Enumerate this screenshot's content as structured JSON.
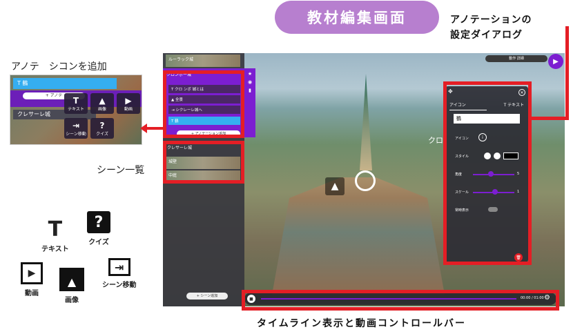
{
  "header": {
    "title": "教材編集画面",
    "dialog_callout": [
      "アノテーションの",
      "設定ダイアログ"
    ],
    "timeline_callout": "タイムライン表示と動画コントロールバー",
    "scene_list_label": "シーン一覧",
    "annotation_add_label": "アノテ　シコンを追加"
  },
  "legend": [
    {
      "icon": "text-icon",
      "glyph": "T",
      "label": "テキスト"
    },
    {
      "icon": "quiz-icon",
      "glyph": "?",
      "label": "クイズ"
    },
    {
      "icon": "video-icon",
      "glyph": "▶",
      "label": "動画"
    },
    {
      "icon": "image-icon",
      "glyph": "▲",
      "label": "画像"
    },
    {
      "icon": "scene-move-icon",
      "glyph": "⇥",
      "label": "シーン移動"
    }
  ],
  "inset": {
    "bar_label": "T 鶴",
    "add_button": "+ アノテ",
    "scene_label": "クレサーレ城",
    "tiles": [
      {
        "glyph": "T",
        "label": "テキスト"
      },
      {
        "glyph": "▲",
        "label": "画像"
      },
      {
        "glyph": "▶",
        "label": "動画"
      },
      {
        "glyph": "⇥",
        "label": "シーン移動"
      },
      {
        "glyph": "?",
        "label": "クイズ"
      }
    ]
  },
  "app": {
    "scene_top": "ルーラック城",
    "panel_title": "クロンボー城",
    "rows": [
      "T クロ ンボ 城とは",
      "▲ 全景",
      "⇥ シクレーレ城へ",
      "T 鶴"
    ],
    "add_annotation": "+ アノテーション追加",
    "scene_list_title": "クレサーレ城",
    "scene_items": [
      "城壁",
      "中庭"
    ],
    "add_scene": "+ シーン追加",
    "top_button": "動作 詳細",
    "hotspot_label": "クロ",
    "timeline_time": "00:00 / 01:00"
  },
  "dialog": {
    "tab_icon": "アイコン",
    "tab_text": "T テキスト",
    "input_value": "鶴",
    "icon_row": "アイコン",
    "style_row": "スタイル",
    "size_row": "角度",
    "size_value": "5",
    "scale_row": "スケール",
    "scale_value": "1",
    "display_row": "常時表示",
    "delete": "🗑"
  }
}
